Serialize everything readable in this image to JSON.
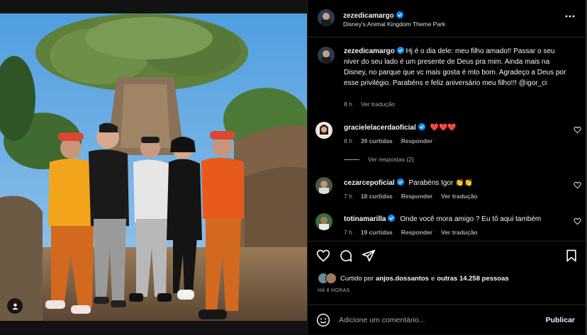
{
  "post": {
    "username": "zezedicamargo",
    "location": "Disney's Animal Kingdom Theme Park",
    "caption_user": "zezedicamargo",
    "caption": "Hj é o dia dele: meu filho amado!! Passar o seu niver do seu lado é um presente de Deus pra mim. Ainda mais na Disney, no parque que vc mais gosta é mto bom. Agradeço a Deus por esse privilégio. Parabéns e feliz aniversário meu filho!!! @igor_ci",
    "caption_age": "8 h",
    "see_translation": "Ver tradução"
  },
  "comments": [
    {
      "user": "gracielelacerdaoficial",
      "text": "❤️❤️❤️",
      "age": "8 h",
      "likes": "39 curtidas",
      "reply": "Responder",
      "translate": ""
    },
    {
      "user": "cezarcepoficial",
      "text": "Parabéns Igor 👏👏",
      "age": "7 h",
      "likes": "18 curtidas",
      "reply": "Responder",
      "translate": "Ver tradução"
    },
    {
      "user": "totinamarilla",
      "text": "Onde você mora amigo ? Eu tô aqui também",
      "age": "7 h",
      "likes": "19 curtidas",
      "reply": "Responder",
      "translate": "Ver tradução"
    }
  ],
  "view_replies": "Ver respostas (2)",
  "likes_line": {
    "prefix": "Curtido por",
    "user": "anjos.dossantos",
    "middle": "e",
    "others": "outras 14.258 pessoas"
  },
  "timestamp": "HÁ 8 HORAS",
  "composer": {
    "placeholder": "Adicione um comentário...",
    "post_label": "Publicar"
  },
  "icons": {
    "verified": "verified-badge-icon",
    "more": "more-options-icon",
    "like": "heart-icon",
    "comment": "comment-icon",
    "share": "share-icon",
    "save": "bookmark-icon",
    "emoji": "emoji-icon",
    "user_tag": "user-tag-icon"
  },
  "colors": {
    "verified": "#0095f6",
    "background": "#000000",
    "muted": "#a8a8a8",
    "heart_red": "#ed4956"
  }
}
